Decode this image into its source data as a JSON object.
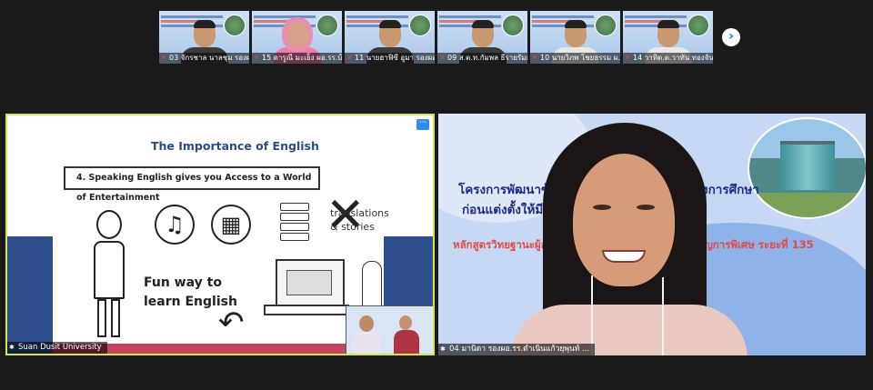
{
  "participants": [
    {
      "name": "03 จักรชาล นาลชุม รองผอ..."
    },
    {
      "name": "15 ดารูณี มะเย็ง ผอ.รร.บ้า..."
    },
    {
      "name": "11 นายฮาฟิซี อูมา รองผอ..."
    },
    {
      "name": "09 ส.ต.ท.กัมพล ธีรายรัมย์..."
    },
    {
      "name": "10 นายวิภพ โชยธรรม ผ..."
    },
    {
      "name": "14 วาทิต.ต.วาทัน ทองจันด..."
    }
  ],
  "next_page_glyph": "›",
  "shared_screen": {
    "presenter": "Suan Dusit University",
    "slide": {
      "title": "The Importance of English",
      "point": "4. Speaking English gives you Access to a World of Entertainment",
      "fun_line1": "Fun way to",
      "fun_line2": "learn English",
      "trans_line1": "translations",
      "trans_line2": "& stories"
    },
    "menu_glyph": "···"
  },
  "active_speaker": {
    "name": "04 มานิดา รองผอ.รร.ดำเนินแก้วยุพุนท์ ...",
    "banner": {
      "line1_left": "โครงการพัฒนาข้าร",
      "line1_right": "งการศึกษา",
      "line2": "ก่อนแต่งตั้งให้มีและ",
      "line3_left": "หลักสูตรวิทยฐานะผู้อำ",
      "line3_right": "ญการพิเศษ ระยะที่ 135"
    }
  },
  "colors": {
    "active_border": "#d8e34f",
    "speaker_bg": "#c6d8f3",
    "slide_blue": "#2f4e8e",
    "slide_red": "#c44461"
  }
}
